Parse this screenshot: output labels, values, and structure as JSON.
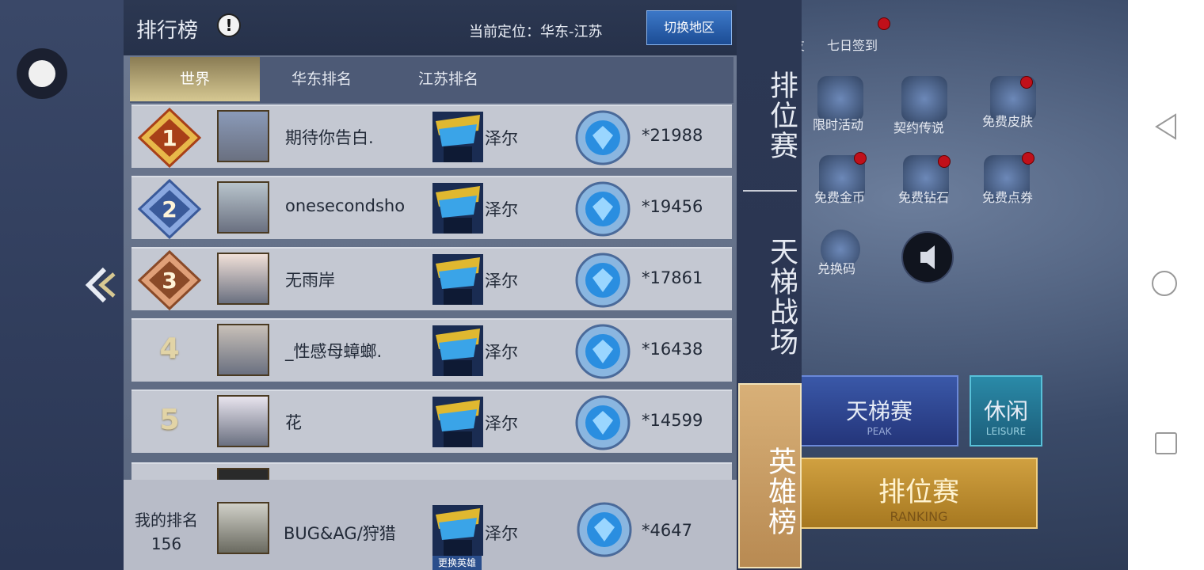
{
  "header": {
    "title": "排行榜",
    "info_icon": "!",
    "location": "当前定位：华东-江苏",
    "switch_button": "切换地区"
  },
  "tabs": [
    {
      "label": "世界",
      "active": true
    },
    {
      "label": "华东排名",
      "active": false
    },
    {
      "label": "江苏排名",
      "active": false
    }
  ],
  "rankings": [
    {
      "rank": "1",
      "name": "期待你告白.",
      "hero": "泽尔",
      "score": "*21988"
    },
    {
      "rank": "2",
      "name": "onesecondsho",
      "hero": "泽尔",
      "score": "*19456"
    },
    {
      "rank": "3",
      "name": "无雨岸",
      "hero": "泽尔",
      "score": "*17861"
    },
    {
      "rank": "4",
      "name": "_性感母蟑螂.",
      "hero": "泽尔",
      "score": "*16438"
    },
    {
      "rank": "5",
      "name": "花",
      "hero": "泽尔",
      "score": "*14599"
    }
  ],
  "my_rank": {
    "label": "我的排名",
    "rank": "156",
    "name": "BUG&AG/狩猎",
    "hero": "泽尔",
    "score": "*4647",
    "change_hero": "更换英雄"
  },
  "side_tabs": [
    {
      "label": "排位赛",
      "active": false
    },
    {
      "label": "天梯战场",
      "active": false
    },
    {
      "label": "英雄榜",
      "active": true
    }
  ],
  "game_menu": {
    "sign_in": "七日签到",
    "friend": "友",
    "items": [
      "限时活动",
      "契约传说",
      "免费皮肤",
      "免费金币",
      "免费钻石",
      "免费点券",
      "兑换码"
    ],
    "ladder_button": {
      "label": "天梯赛",
      "sub": "PEAK"
    },
    "leisure_button": {
      "label": "休闲",
      "sub": "LEISURE"
    },
    "ranking_button": {
      "label": "排位赛",
      "sub": "RANKING"
    }
  },
  "colors": {
    "accent_gold": "#d6c892",
    "switch_blue": "#3c78c8",
    "panel_bg": "#6e7a92",
    "row_bg": "#c4c8d2"
  }
}
